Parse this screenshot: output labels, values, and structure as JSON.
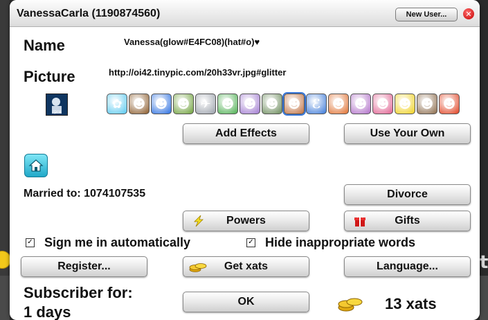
{
  "window": {
    "title": "VanessaCarla (1190874560)",
    "new_user_label": "New User...",
    "close_icon": "close-icon"
  },
  "profile": {
    "name_label": "Name",
    "name_prefix": "",
    "name_value": "Vanessa(glow#E4FC08)(hat#o)♥",
    "picture_label": "Picture",
    "picture_value": "http://oi42.tinypic.com/20h33vr.jpg#glitter"
  },
  "avatars": [
    {
      "icon": "avatar-blue-creature-icon",
      "color": "#58c8f0",
      "glyph": "✿"
    },
    {
      "icon": "avatar-face-dark-hair-icon",
      "color": "#8a5a2a",
      "glyph": "☻"
    },
    {
      "icon": "avatar-marge-icon",
      "color": "#2a6ee0",
      "glyph": "☻"
    },
    {
      "icon": "avatar-green-kid-icon",
      "color": "#6ea03a",
      "glyph": "☻"
    },
    {
      "icon": "avatar-spaceship-icon",
      "color": "#9aa0aa",
      "glyph": "✈"
    },
    {
      "icon": "avatar-green-witch-icon",
      "color": "#4caf50",
      "glyph": "☻"
    },
    {
      "icon": "avatar-bald-man-icon",
      "color": "#a07ad0",
      "glyph": "☻"
    },
    {
      "icon": "avatar-zombie-icon",
      "color": "#6a8a5a",
      "glyph": "☻"
    },
    {
      "icon": "avatar-alien-head-icon",
      "color": "#c07040",
      "glyph": "☻"
    },
    {
      "icon": "avatar-blue-dragon-icon",
      "color": "#3a78d8",
      "glyph": "ℰ"
    },
    {
      "icon": "avatar-orange-monster-icon",
      "color": "#e07030",
      "glyph": "☻"
    },
    {
      "icon": "avatar-purple-alien-icon",
      "color": "#b070c8",
      "glyph": "☻"
    },
    {
      "icon": "avatar-pink-creature-icon",
      "color": "#e06090",
      "glyph": "☻"
    },
    {
      "icon": "avatar-tweety-icon",
      "color": "#f0d020",
      "glyph": "☻"
    },
    {
      "icon": "avatar-dog-icon",
      "color": "#8a6a4a",
      "glyph": "☻"
    },
    {
      "icon": "avatar-red-hair-icon",
      "color": "#e04020",
      "glyph": "☻"
    }
  ],
  "buttons": {
    "add_effects": "Add Effects",
    "use_your_own": "Use Your Own",
    "divorce": "Divorce",
    "powers": "Powers",
    "gifts": "Gifts",
    "register": "Register...",
    "get_xats": "Get xats",
    "language": "Language...",
    "ok": "OK"
  },
  "married_to": "Married to: 1074107535",
  "checkboxes": {
    "sign_in": {
      "label": "Sign me in automatically",
      "checked": true
    },
    "hide_words": {
      "label": "Hide inappropriate words",
      "checked": true
    }
  },
  "subscriber": {
    "line1": "Subscriber for:",
    "line2": "1 days"
  },
  "xats": "13 xats",
  "colors": {
    "accent": "#20a8c8",
    "close": "#d40000"
  }
}
